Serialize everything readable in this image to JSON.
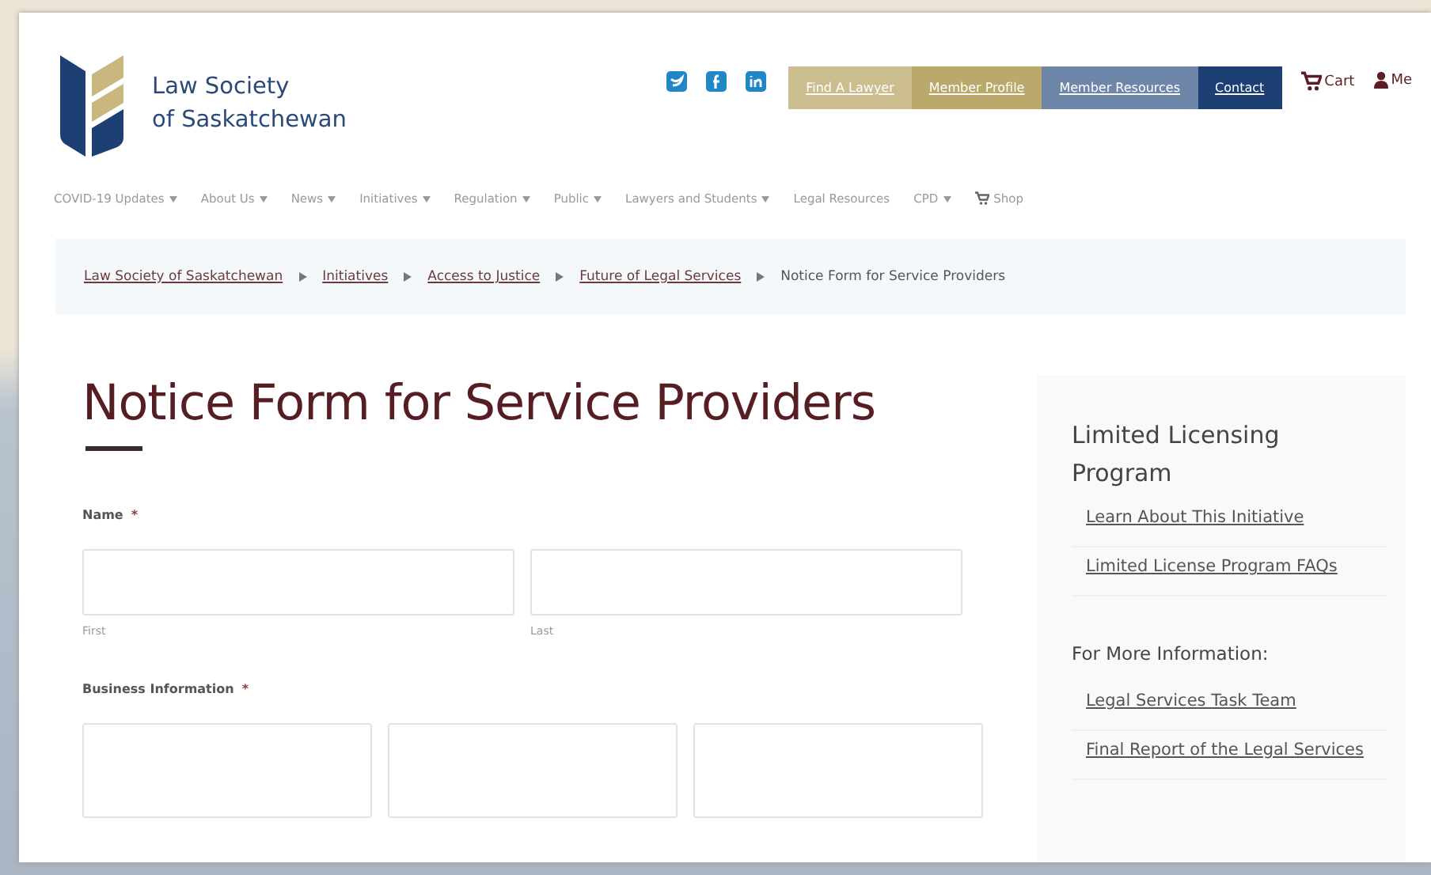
{
  "header": {
    "logo_lines": [
      "Law Society",
      "of Saskatchewan"
    ],
    "utility_links": [
      {
        "label": "Find A Lawyer",
        "color": "#cbbd8e"
      },
      {
        "label": "Member Profile",
        "color": "#bba96c"
      },
      {
        "label": "Member Resources",
        "color": "#6e87a8"
      },
      {
        "label": "Contact",
        "color": "#1e3f74"
      }
    ],
    "cart": "Cart",
    "account": "Me"
  },
  "nav": [
    {
      "label": "COVID-19 Updates",
      "kind": "dropdown"
    },
    {
      "label": "About Us",
      "kind": "dropdown"
    },
    {
      "label": "News",
      "kind": "dropdown"
    },
    {
      "label": "Initiatives",
      "kind": "dropdown"
    },
    {
      "label": "Regulation",
      "kind": "dropdown"
    },
    {
      "label": "Public",
      "kind": "dropdown"
    },
    {
      "label": "Lawyers and Students",
      "kind": "dropdown"
    },
    {
      "label": "Legal Resources",
      "kind": "link"
    },
    {
      "label": "CPD",
      "kind": "dropdown"
    },
    {
      "label": "Shop",
      "kind": "cart"
    }
  ],
  "breadcrumb": [
    {
      "label": "Law Society of Saskatchewan",
      "current": false
    },
    {
      "label": "Initiatives",
      "current": false
    },
    {
      "label": "Access to Justice",
      "current": false
    },
    {
      "label": "Future of Legal Services",
      "current": false
    },
    {
      "label": "Notice Form for Service Providers",
      "current": true
    }
  ],
  "title": "Notice Form for Service Providers",
  "form": [
    {
      "label": "Name",
      "required_mark": "*",
      "inputs": [
        {
          "kind": "labeled",
          "sublabel": "First"
        },
        {
          "kind": "labeled",
          "sublabel": "Last"
        }
      ]
    },
    {
      "label": "Business Information",
      "required_mark": "*",
      "inputs": [
        {
          "kind": "blank"
        },
        {
          "kind": "blank"
        },
        {
          "kind": "blank"
        }
      ]
    }
  ],
  "sidebar": [
    {
      "heading": "Limited Licensing Program",
      "links": [
        "Learn About This Initiative",
        "Limited License Program FAQs"
      ]
    },
    {
      "heading": "For More Information:",
      "links": [
        "Legal Services Task Team",
        "Final Report of the Legal Services"
      ]
    }
  ]
}
